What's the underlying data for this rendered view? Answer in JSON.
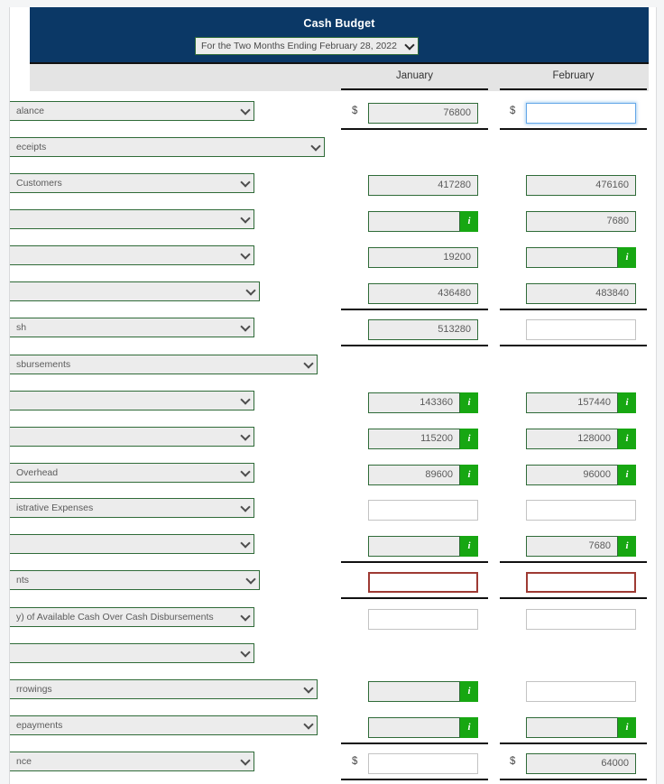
{
  "panel": {
    "title": "Cash Budget",
    "period_select": {
      "value": "For the Two Months Ending February 28, 2022",
      "icon": "chevron-down-icon"
    },
    "columns": [
      "January",
      "February"
    ],
    "currency_symbol": "$"
  },
  "rows": [
    {
      "id": "beginning-cash-balance",
      "label": "alance",
      "select_width": 272,
      "january": {
        "value": "76800",
        "state": "readonly",
        "dollar": true,
        "badge": false,
        "underline": true
      },
      "february": {
        "value": "",
        "state": "focus",
        "dollar": true,
        "badge": false,
        "underline": true
      }
    },
    {
      "id": "cash-receipts-header",
      "label": "eceipts",
      "select_width": 350,
      "january": {
        "value": "",
        "state": "none",
        "dollar": false,
        "badge": false,
        "underline": false
      },
      "february": {
        "value": "",
        "state": "none",
        "dollar": false,
        "badge": false,
        "underline": false
      }
    },
    {
      "id": "collections-from-customers",
      "label": " Customers",
      "select_width": 272,
      "january": {
        "value": "417280",
        "state": "readonly",
        "dollar": false,
        "badge": false,
        "underline": false
      },
      "february": {
        "value": "476160",
        "state": "readonly",
        "dollar": false,
        "badge": false,
        "underline": false
      }
    },
    {
      "id": "receipts-row-2",
      "label": "",
      "select_width": 272,
      "january": {
        "value": "",
        "state": "readonly",
        "dollar": false,
        "badge": true,
        "underline": false
      },
      "february": {
        "value": "7680",
        "state": "readonly",
        "dollar": false,
        "badge": false,
        "underline": false
      }
    },
    {
      "id": "receipts-row-3",
      "label": "",
      "select_width": 272,
      "january": {
        "value": "19200",
        "state": "readonly",
        "dollar": false,
        "badge": false,
        "underline": false
      },
      "february": {
        "value": "",
        "state": "readonly",
        "dollar": false,
        "badge": true,
        "underline": false
      }
    },
    {
      "id": "total-cash-receipts",
      "label": "",
      "select_width": 278,
      "january": {
        "value": "436480",
        "state": "readonly",
        "dollar": false,
        "badge": false,
        "underline": true
      },
      "february": {
        "value": "483840",
        "state": "readonly",
        "dollar": false,
        "badge": false,
        "underline": true
      }
    },
    {
      "id": "total-cash-available",
      "label": "sh",
      "select_width": 272,
      "january": {
        "value": "513280",
        "state": "readonly",
        "dollar": false,
        "badge": false,
        "underline": true
      },
      "february": {
        "value": "",
        "state": "empty",
        "dollar": false,
        "badge": false,
        "underline": true
      }
    },
    {
      "id": "cash-disbursements-header",
      "label": "sbursements",
      "select_width": 342,
      "january": {
        "value": "",
        "state": "none",
        "dollar": false,
        "badge": false,
        "underline": false
      },
      "february": {
        "value": "",
        "state": "none",
        "dollar": false,
        "badge": false,
        "underline": false
      }
    },
    {
      "id": "disbursement-row-1",
      "label": "",
      "select_width": 272,
      "january": {
        "value": "143360",
        "state": "readonly",
        "dollar": false,
        "badge": true,
        "underline": false
      },
      "february": {
        "value": "157440",
        "state": "readonly",
        "dollar": false,
        "badge": true,
        "underline": false
      }
    },
    {
      "id": "disbursement-row-2",
      "label": "",
      "select_width": 272,
      "january": {
        "value": "115200",
        "state": "readonly",
        "dollar": false,
        "badge": true,
        "underline": false
      },
      "february": {
        "value": "128000",
        "state": "readonly",
        "dollar": false,
        "badge": true,
        "underline": false
      }
    },
    {
      "id": "manufacturing-overhead",
      "label": "Overhead",
      "select_width": 272,
      "january": {
        "value": "89600",
        "state": "readonly",
        "dollar": false,
        "badge": true,
        "underline": false
      },
      "february": {
        "value": "96000",
        "state": "readonly",
        "dollar": false,
        "badge": true,
        "underline": false
      }
    },
    {
      "id": "selling-administrative-expenses",
      "label": "istrative Expenses",
      "select_width": 272,
      "january": {
        "value": "",
        "state": "empty",
        "dollar": false,
        "badge": false,
        "underline": false
      },
      "february": {
        "value": "",
        "state": "empty",
        "dollar": false,
        "badge": false,
        "underline": false
      }
    },
    {
      "id": "disbursement-row-4",
      "label": "",
      "select_width": 272,
      "january": {
        "value": "",
        "state": "readonly",
        "dollar": false,
        "badge": true,
        "underline": true
      },
      "february": {
        "value": "7680",
        "state": "readonly",
        "dollar": false,
        "badge": true,
        "underline": true
      }
    },
    {
      "id": "total-cash-disbursements",
      "label": "nts",
      "select_width": 278,
      "january": {
        "value": "",
        "state": "error",
        "dollar": false,
        "badge": false,
        "underline": true
      },
      "february": {
        "value": "",
        "state": "error",
        "dollar": false,
        "badge": false,
        "underline": true
      }
    },
    {
      "id": "excess-deficiency-available-cash",
      "label": "y) of Available Cash Over Cash Disbursements",
      "select_width": 272,
      "january": {
        "value": "",
        "state": "empty",
        "dollar": false,
        "badge": false,
        "underline": false
      },
      "february": {
        "value": "",
        "state": "empty",
        "dollar": false,
        "badge": false,
        "underline": false
      }
    },
    {
      "id": "financing-header",
      "label": "",
      "select_width": 272,
      "january": {
        "value": "",
        "state": "none",
        "dollar": false,
        "badge": false,
        "underline": false
      },
      "february": {
        "value": "",
        "state": "none",
        "dollar": false,
        "badge": false,
        "underline": false
      }
    },
    {
      "id": "borrowings",
      "label": "rrowings",
      "select_width": 342,
      "january": {
        "value": "",
        "state": "readonly",
        "dollar": false,
        "badge": true,
        "underline": false
      },
      "february": {
        "value": "",
        "state": "empty",
        "dollar": false,
        "badge": false,
        "underline": false
      }
    },
    {
      "id": "repayments",
      "label": "epayments",
      "select_width": 342,
      "january": {
        "value": "",
        "state": "readonly",
        "dollar": false,
        "badge": true,
        "underline": true
      },
      "february": {
        "value": "",
        "state": "readonly",
        "dollar": false,
        "badge": true,
        "underline": true
      }
    },
    {
      "id": "ending-cash-balance",
      "label": "nce",
      "select_width": 272,
      "january": {
        "value": "",
        "state": "empty",
        "dollar": true,
        "badge": false,
        "underline": true
      },
      "february": {
        "value": "64000",
        "state": "readonly",
        "dollar": true,
        "badge": false,
        "underline": true
      }
    }
  ],
  "badge_label": "i",
  "colors": {
    "header_navy": "#0b3866",
    "field_border_green": "#2f6b38",
    "badge_green": "#17a712",
    "error_red": "#9e3a33",
    "focus_blue": "#63a7e8",
    "header_band_gray": "#e4e4e4"
  }
}
